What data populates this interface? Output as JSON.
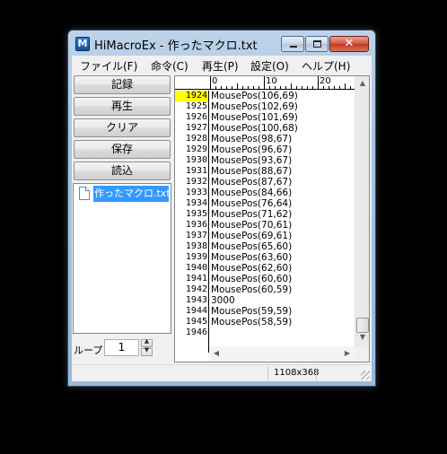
{
  "window": {
    "title": "HiMacroEx - 作ったマクロ.txt",
    "app_icon_letter": "M"
  },
  "menu": [
    "ファイル(F)",
    "命令(C)",
    "再生(P)",
    "設定(O)",
    "ヘルプ(H)"
  ],
  "side_buttons": [
    "記録",
    "再生",
    "クリア",
    "保存",
    "読込"
  ],
  "file_list": {
    "items": [
      "作ったマクロ.txt"
    ],
    "selected_index": 0
  },
  "loop": {
    "label": "ループ",
    "value": "1"
  },
  "editor": {
    "ruler_labels": [
      "0",
      "10",
      "20"
    ],
    "current_line": "1924",
    "lines": [
      {
        "no": "1924",
        "text": "MousePos(106,69)"
      },
      {
        "no": "1925",
        "text": "MousePos(102,69)"
      },
      {
        "no": "1926",
        "text": "MousePos(101,69)"
      },
      {
        "no": "1927",
        "text": "MousePos(100,68)"
      },
      {
        "no": "1928",
        "text": "MousePos(98,67)"
      },
      {
        "no": "1929",
        "text": "MousePos(96,67)"
      },
      {
        "no": "1930",
        "text": "MousePos(93,67)"
      },
      {
        "no": "1931",
        "text": "MousePos(88,67)"
      },
      {
        "no": "1932",
        "text": "MousePos(87,67)"
      },
      {
        "no": "1933",
        "text": "MousePos(84,66)"
      },
      {
        "no": "1934",
        "text": "MousePos(76,64)"
      },
      {
        "no": "1935",
        "text": "MousePos(71,62)"
      },
      {
        "no": "1936",
        "text": "MousePos(70,61)"
      },
      {
        "no": "1937",
        "text": "MousePos(69,61)"
      },
      {
        "no": "1938",
        "text": "MousePos(65,60)"
      },
      {
        "no": "1939",
        "text": "MousePos(63,60)"
      },
      {
        "no": "1940",
        "text": "MousePos(62,60)"
      },
      {
        "no": "1941",
        "text": "MousePos(60,60)"
      },
      {
        "no": "1942",
        "text": "MousePos(60,59)"
      },
      {
        "no": "1943",
        "text": "3000"
      },
      {
        "no": "1944",
        "text": "MousePos(59,59)"
      },
      {
        "no": "1945",
        "text": "MousePos(58,59)"
      },
      {
        "no": "1946",
        "text": ""
      }
    ]
  },
  "status": {
    "size": "1108x368"
  },
  "colors": {
    "current_line_highlight": "#ffff00",
    "selection": "#3399ff",
    "close_button": "#c8452e"
  }
}
